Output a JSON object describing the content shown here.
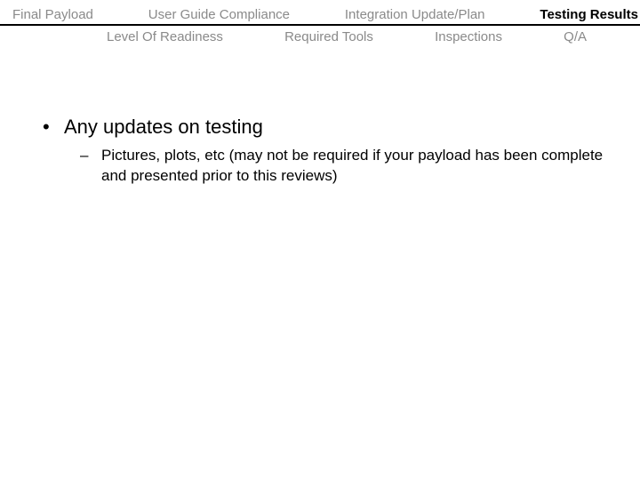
{
  "tabs": {
    "row1": [
      {
        "label": "Final Payload",
        "active": false
      },
      {
        "label": "User Guide Compliance",
        "active": false
      },
      {
        "label": "Integration Update/Plan",
        "active": false
      },
      {
        "label": "Testing Results",
        "active": true
      }
    ],
    "row2": [
      {
        "label": "Level Of Readiness",
        "active": false
      },
      {
        "label": "Required Tools",
        "active": false
      },
      {
        "label": "Inspections",
        "active": false
      },
      {
        "label": "Q/A",
        "active": false
      }
    ]
  },
  "content": {
    "bullet1": "Any updates on testing",
    "sub1": "Pictures, plots, etc (may not be required if your payload has been complete and presented prior to this reviews)"
  }
}
